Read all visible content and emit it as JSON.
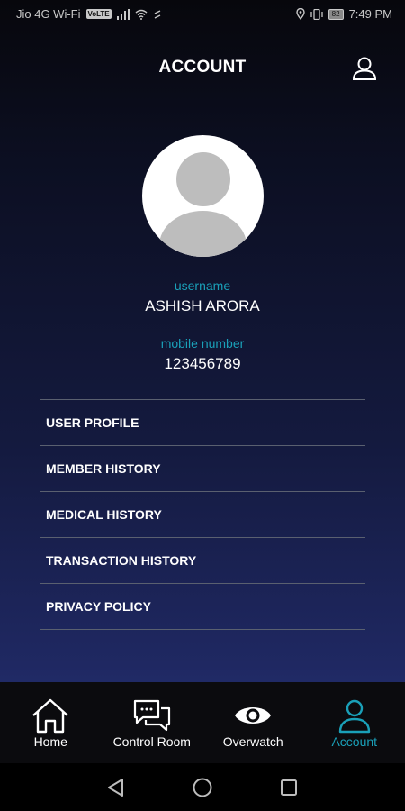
{
  "status_bar": {
    "carrier": "Jio 4G Wi-Fi",
    "hd_badge": "VoLTE",
    "battery": "82",
    "time": "7:49 PM"
  },
  "header": {
    "title": "ACCOUNT",
    "profile_icon": "user-outline-icon"
  },
  "profile": {
    "avatar_icon": "default-avatar-icon",
    "username_label": "username",
    "username_value": "ASHISH ARORA",
    "mobile_label": "mobile number",
    "mobile_value": "123456789"
  },
  "menu": {
    "items": [
      {
        "label": "USER PROFILE"
      },
      {
        "label": "MEMBER HISTORY"
      },
      {
        "label": "MEDICAL HISTORY"
      },
      {
        "label": "TRANSACTION HISTORY"
      },
      {
        "label": "PRIVACY POLICY"
      }
    ]
  },
  "tabs": [
    {
      "label": "Home",
      "icon": "home-icon",
      "active": false
    },
    {
      "label": "Control Room",
      "icon": "chat-icon",
      "active": false
    },
    {
      "label": "Overwatch",
      "icon": "eye-icon",
      "active": false
    },
    {
      "label": "Account",
      "icon": "user-icon",
      "active": true
    }
  ],
  "nav": {
    "back_icon": "back-triangle-icon",
    "home_icon": "home-circle-icon",
    "recents_icon": "recents-square-icon"
  },
  "colors": {
    "accent": "#1aa0b8",
    "background_top": "#07070c",
    "background_bottom": "#202a66",
    "tab_bar": "#0b0b0e"
  }
}
